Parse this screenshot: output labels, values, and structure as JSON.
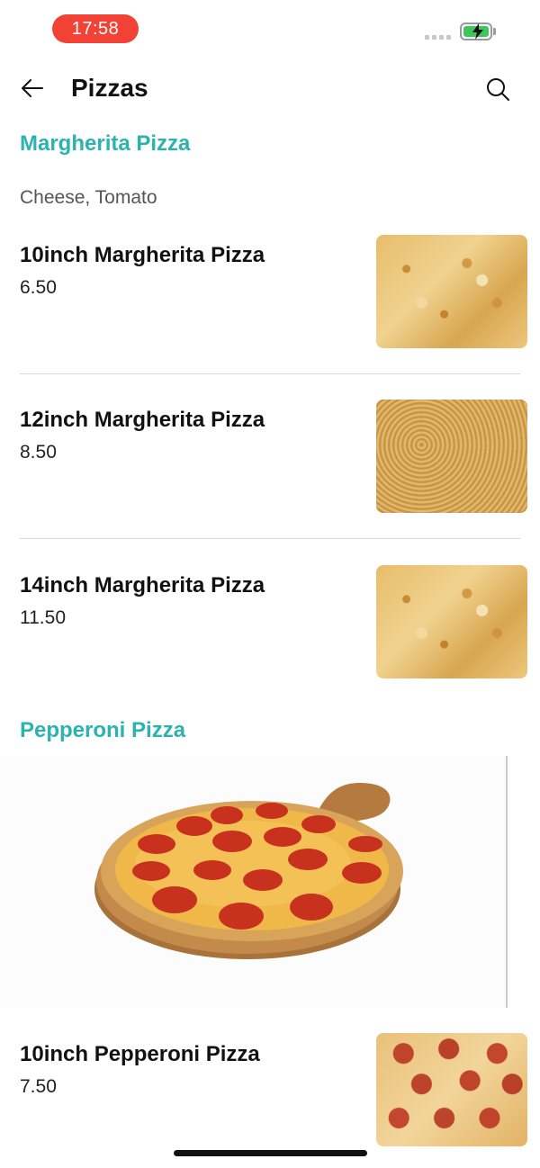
{
  "status_bar": {
    "time": "17:58"
  },
  "header": {
    "title": "Pizzas"
  },
  "sections": [
    {
      "title": "Margherita Pizza",
      "description": "Cheese, Tomato",
      "items": [
        {
          "name": "10inch Margherita Pizza",
          "price": "6.50"
        },
        {
          "name": "12inch Margherita Pizza",
          "price": "8.50"
        },
        {
          "name": "14inch Margherita Pizza",
          "price": "11.50"
        }
      ]
    },
    {
      "title": "Pepperoni Pizza",
      "items": [
        {
          "name": "10inch Pepperoni Pizza",
          "price": "7.50"
        }
      ]
    }
  ],
  "icons": {
    "back": "arrow-left-icon",
    "search": "search-icon",
    "battery": "battery-charging-icon",
    "signal": "signal-icon"
  },
  "colors": {
    "accent": "#2bb3b0",
    "time_pill": "#f24236",
    "battery_fill": "#3cc75a"
  }
}
